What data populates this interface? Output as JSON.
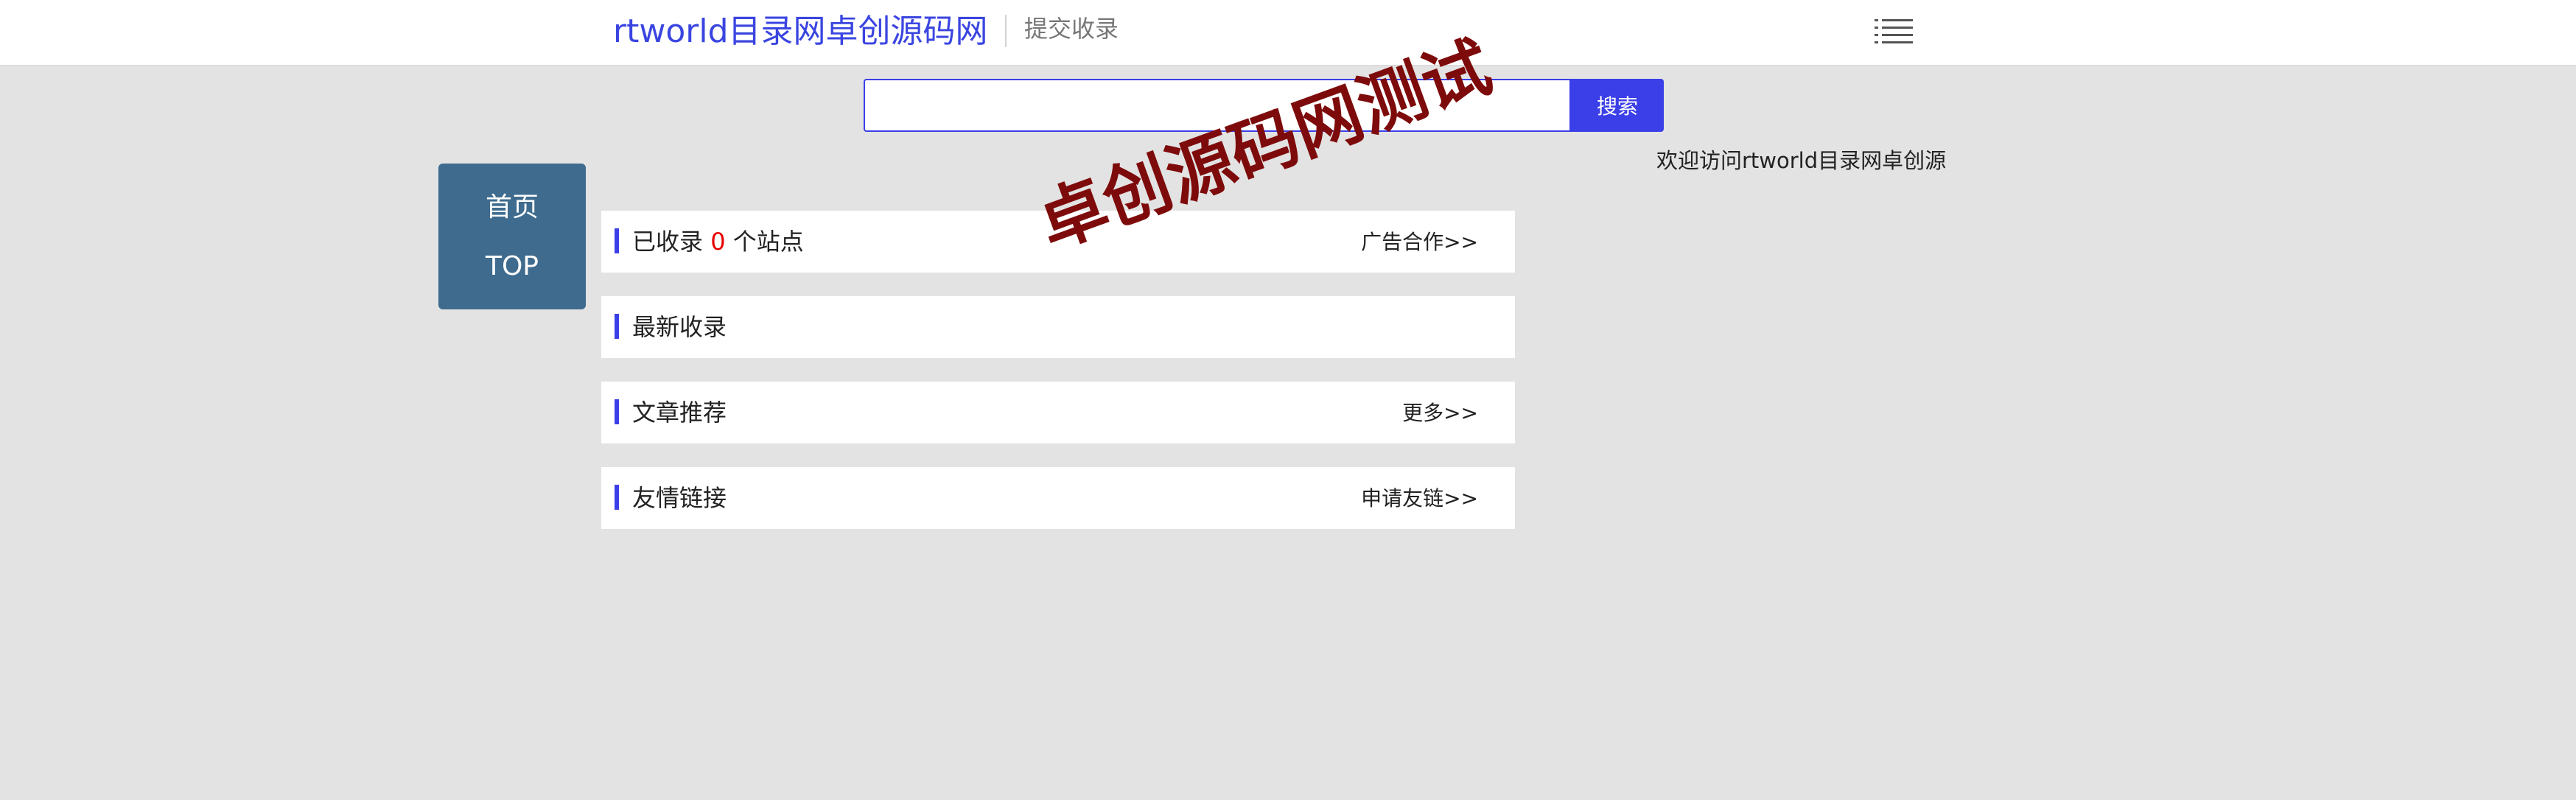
{
  "header": {
    "site_title": "rtworld目录网卓创源码网",
    "submit_link": "提交收录"
  },
  "search": {
    "value": "",
    "placeholder": "",
    "button_label": "搜索"
  },
  "welcome_text": "欢迎访问rtworld目录网卓创源",
  "left_nav": {
    "items": [
      {
        "label": "首页"
      },
      {
        "label": "TOP"
      }
    ]
  },
  "panels": {
    "collected": {
      "title_prefix": "已收录",
      "count": "0",
      "title_suffix": "个站点",
      "link": "广告合作>>"
    },
    "latest": {
      "title": "最新收录"
    },
    "articles": {
      "title": "文章推荐",
      "link": "更多>>"
    },
    "friends": {
      "title": "友情链接",
      "link": "申请友链>>"
    }
  },
  "watermark": "卓创源码网测试",
  "colors": {
    "accent": "#3b3fe8",
    "nav_background": "#3f6b8e",
    "count_highlight": "#e60000",
    "watermark": "#7e0b0b"
  },
  "icons": {
    "menu": "menu-list-icon"
  }
}
